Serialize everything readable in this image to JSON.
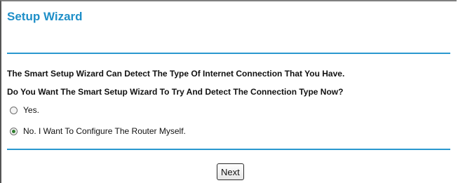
{
  "wizard": {
    "title": "Setup Wizard",
    "question_line1": "The Smart Setup Wizard Can Detect The Type Of Internet Connection That You Have.",
    "question_line2": "Do You Want The Smart Setup Wizard To Try And Detect The Connection Type Now?",
    "options": [
      {
        "label": "Yes.",
        "selected": false
      },
      {
        "label": "No. I Want To Configure The Router Myself.",
        "selected": true
      }
    ],
    "next_label": "Next"
  },
  "colors": {
    "title": "#1f8fc8",
    "rule": "#2a98cf"
  }
}
